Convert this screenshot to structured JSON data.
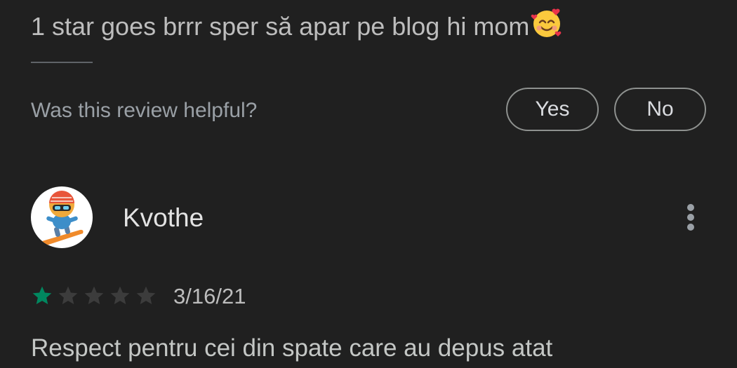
{
  "previous_review": {
    "text": "1 star goes brrr sper să apar pe blog hi mom",
    "emoji_icon": "smiling-face-with-hearts-icon"
  },
  "helpful": {
    "question": "Was this review helpful?",
    "yes_label": "Yes",
    "no_label": "No"
  },
  "review": {
    "reviewer_name": "Kvothe",
    "rating": 1,
    "max_rating": 5,
    "date": "3/16/21",
    "body": "Respect pentru cei din spate care au depus atat"
  },
  "colors": {
    "background": "#202020",
    "star_filled": "#01875f",
    "star_empty": "#3c3c3c"
  }
}
